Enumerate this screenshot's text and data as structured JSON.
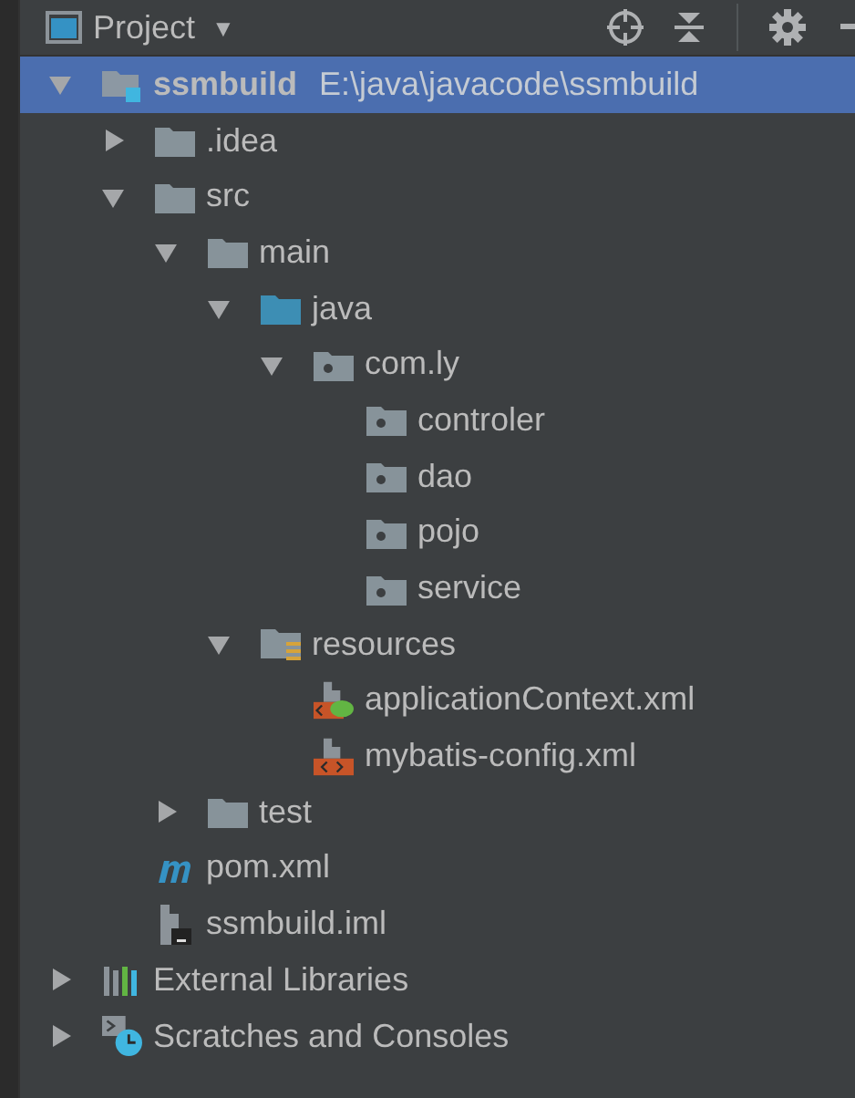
{
  "panel": {
    "title": "Project",
    "caret": "▼"
  },
  "tree": [
    {
      "label": "ssmbuild",
      "path": "E:\\java\\javacode\\ssmbuild",
      "kind": "module",
      "expanded": true,
      "selected": true,
      "children": [
        {
          "label": ".idea",
          "kind": "folder",
          "expanded": false,
          "selected": false
        },
        {
          "label": "src",
          "kind": "folder",
          "expanded": true,
          "selected": false,
          "children": [
            {
              "label": "main",
              "kind": "folder",
              "expanded": true,
              "selected": false,
              "children": [
                {
                  "label": "java",
                  "kind": "source",
                  "expanded": true,
                  "selected": false,
                  "children": [
                    {
                      "label": "com.ly",
                      "kind": "package",
                      "expanded": true,
                      "selected": false,
                      "children": [
                        {
                          "label": "controler",
                          "kind": "package",
                          "selected": false
                        },
                        {
                          "label": "dao",
                          "kind": "package",
                          "selected": false
                        },
                        {
                          "label": "pojo",
                          "kind": "package",
                          "selected": false
                        },
                        {
                          "label": "service",
                          "kind": "package",
                          "selected": false
                        }
                      ]
                    }
                  ]
                },
                {
                  "label": "resources",
                  "kind": "resources",
                  "expanded": true,
                  "selected": false,
                  "children": [
                    {
                      "label": "applicationContext.xml",
                      "kind": "spring-xml",
                      "selected": false
                    },
                    {
                      "label": "mybatis-config.xml",
                      "kind": "xml",
                      "selected": false
                    }
                  ]
                }
              ]
            },
            {
              "label": "test",
              "kind": "folder",
              "expanded": false,
              "selected": false
            }
          ]
        },
        {
          "label": "pom.xml",
          "kind": "maven",
          "selected": false
        },
        {
          "label": "ssmbuild.iml",
          "kind": "iml",
          "selected": false
        }
      ]
    },
    {
      "label": "External Libraries",
      "kind": "libraries",
      "expanded": false,
      "selected": false
    },
    {
      "label": "Scratches and Consoles",
      "kind": "scratches",
      "expanded": false,
      "selected": false
    }
  ]
}
